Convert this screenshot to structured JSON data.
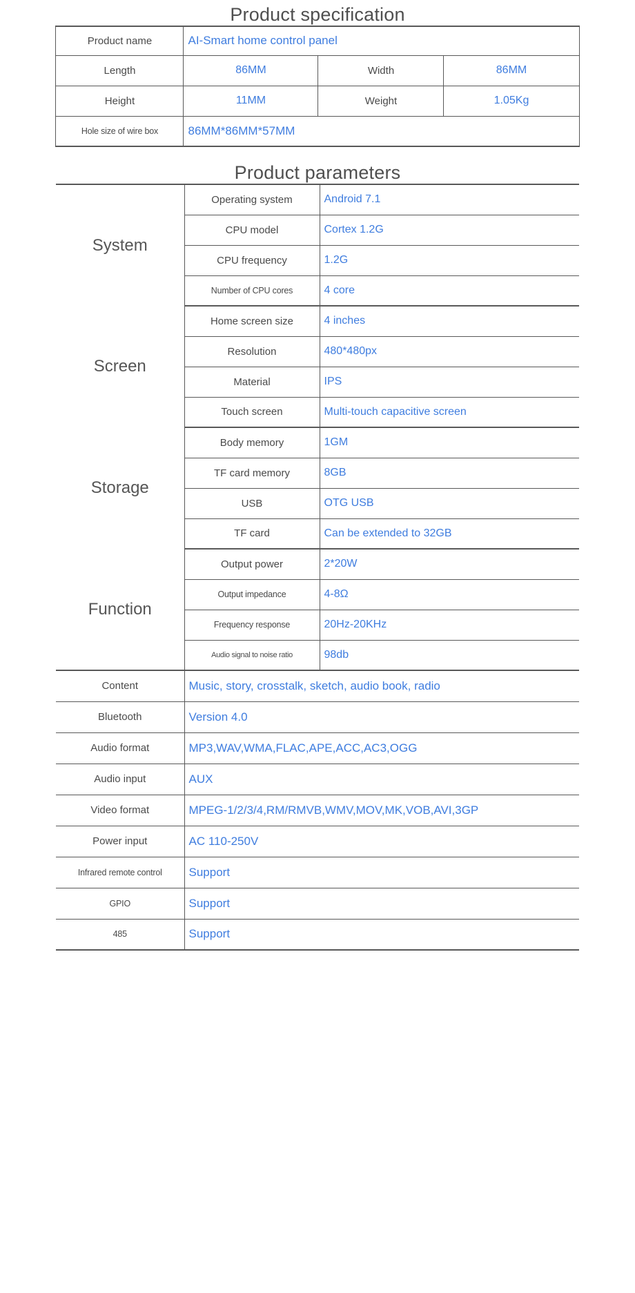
{
  "theme": {
    "accent_blue": "#3f7ddf",
    "label_gray": "#4a4a4a",
    "rule_gray": "#585858",
    "background": "#ffffff"
  },
  "spec_section": {
    "title": "Product specification",
    "rows": [
      {
        "label": "Product name",
        "value": "AI-Smart home control panel",
        "span": "full"
      },
      {
        "label": "Length",
        "value": "86MM",
        "label2": "Width",
        "value2": "86MM",
        "span": "quad"
      },
      {
        "label": "Height",
        "value": "11MM",
        "label2": "Weight",
        "value2": "1.05Kg",
        "span": "quad"
      },
      {
        "label": "Hole size of wire box",
        "value": "86MM*86MM*57MM",
        "span": "full"
      }
    ]
  },
  "params_section": {
    "title": "Product parameters",
    "groups": [
      {
        "name": "System",
        "rows": [
          {
            "key": "Operating system",
            "value": "Android 7.1"
          },
          {
            "key": "CPU model",
            "value": "Cortex 1.2G"
          },
          {
            "key": "CPU frequency",
            "value": "1.2G"
          },
          {
            "key": "Number of CPU cores",
            "value": "4 core"
          }
        ]
      },
      {
        "name": "Screen",
        "rows": [
          {
            "key": "Home screen size",
            "value": "4 inches"
          },
          {
            "key": "Resolution",
            "value": "480*480px"
          },
          {
            "key": "Material",
            "value": "IPS"
          },
          {
            "key": "Touch screen",
            "value": "Multi-touch capacitive screen"
          }
        ]
      },
      {
        "name": "Storage",
        "rows": [
          {
            "key": "Body memory",
            "value": "1GM"
          },
          {
            "key": "TF card memory",
            "value": "8GB"
          },
          {
            "key": "USB",
            "value": "OTG USB"
          },
          {
            "key": "TF card",
            "value": "Can be extended to 32GB"
          }
        ]
      },
      {
        "name": "Function",
        "rows": [
          {
            "key": "Output power",
            "value": "2*20W"
          },
          {
            "key": "Output impedance",
            "value": "4-8Ω"
          },
          {
            "key": "Frequency response",
            "value": "20Hz-20KHz"
          },
          {
            "key": "Audio signal to noise ratio",
            "value": "98db"
          }
        ]
      }
    ],
    "plain_rows": [
      {
        "key": "Content",
        "value": "Music, story, crosstalk, sketch, audio book, radio"
      },
      {
        "key": "Bluetooth",
        "value": "Version 4.0"
      },
      {
        "key": "Audio format",
        "value": "MP3,WAV,WMA,FLAC,APE,ACC,AC3,OGG"
      },
      {
        "key": "Audio input",
        "value": "AUX"
      },
      {
        "key": "Video format",
        "value": "MPEG-1/2/3/4,RM/RMVB,WMV,MOV,MK,VOB,AVI,3GP"
      },
      {
        "key": "Power input",
        "value": "AC 110-250V"
      },
      {
        "key": "Infrared remote control",
        "value": "Support"
      },
      {
        "key": "GPIO",
        "value": "Support"
      },
      {
        "key": "485",
        "value": "Support"
      }
    ]
  }
}
